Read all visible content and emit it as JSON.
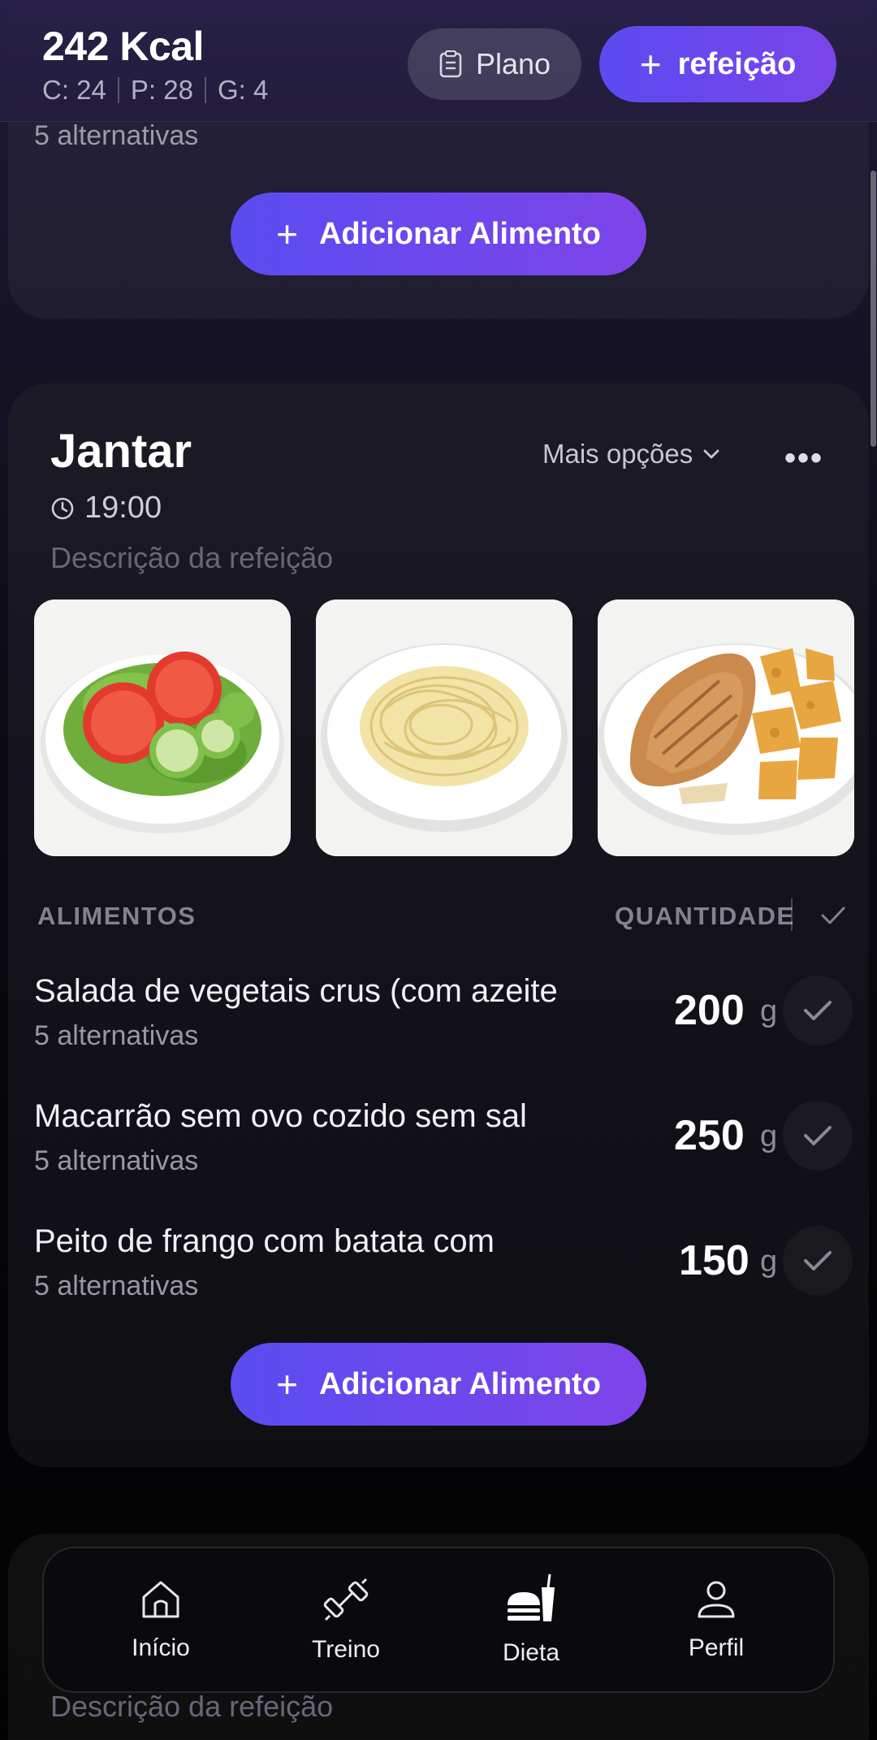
{
  "header": {
    "kcal": "242 Kcal",
    "macros": {
      "c": "C: 24",
      "p": "P: 28",
      "g": "G: 4"
    },
    "plano_label": "Plano",
    "refeicao_label": "refeição"
  },
  "prev_meal": {
    "last_food_alternatives": "5 alternativas",
    "add_food_label": "Adicionar Alimento"
  },
  "meal": {
    "title": "Jantar",
    "time": "19:00",
    "description": "Descrição da refeição",
    "more_options_label": "Mais opções",
    "columns": {
      "foods": "ALIMENTOS",
      "quantity": "QUANTIDADE"
    },
    "foods": [
      {
        "name": "Salada de vegetais crus (com azeite",
        "alternatives": "5 alternativas",
        "quantity": "200",
        "unit": "g"
      },
      {
        "name": "Macarrão sem ovo cozido sem sal",
        "alternatives": "5 alternativas",
        "quantity": "250",
        "unit": "g"
      },
      {
        "name": "Peito de frango com batata com",
        "alternatives": "5 alternativas",
        "quantity": "150",
        "unit": "g"
      }
    ],
    "add_food_label": "Adicionar Alimento"
  },
  "next_meal": {
    "description": "Descrição da refeição"
  },
  "nav": {
    "items": [
      {
        "label": "Início",
        "icon": "home-icon"
      },
      {
        "label": "Treino",
        "icon": "dumbbell-icon"
      },
      {
        "label": "Dieta",
        "icon": "burger-drink-icon",
        "active": true
      },
      {
        "label": "Perfil",
        "icon": "person-icon"
      }
    ]
  },
  "colors": {
    "accent_start": "#5a4cf0",
    "accent_end": "#7e44ea"
  }
}
